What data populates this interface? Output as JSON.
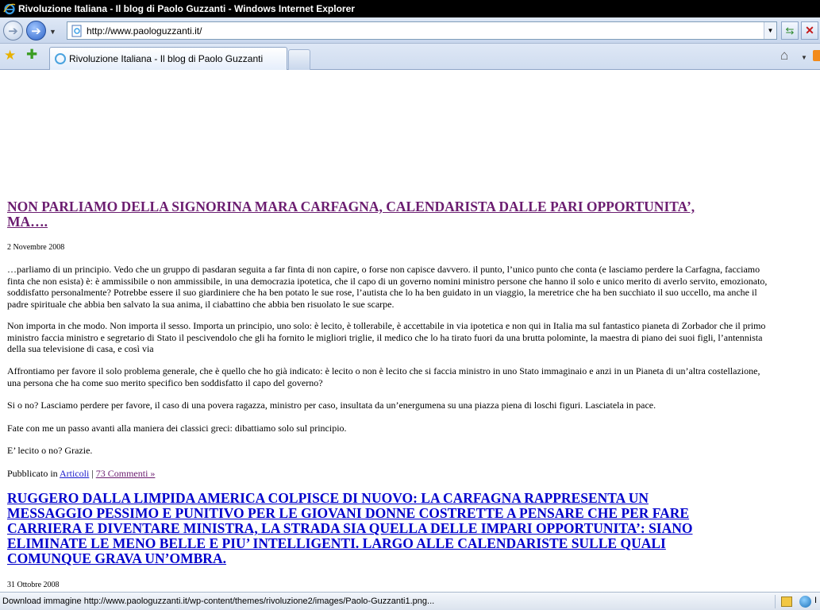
{
  "window": {
    "title": "Rivoluzione Italiana - Il blog di Paolo Guzzanti - Windows Internet Explorer",
    "url": "http://www.paologuzzanti.it/",
    "tab_label": "Rivoluzione Italiana - Il blog di Paolo Guzzanti"
  },
  "icons": {
    "back": "back-arrow-icon",
    "forward": "forward-arrow-icon",
    "refresh": "refresh-icon",
    "stop": "stop-icon",
    "favorites": "favorites-star-icon",
    "add_favorites": "add-favorites-icon",
    "home": "home-icon"
  },
  "colors": {
    "visited_link": "#6b1d70",
    "link": "#0000cc"
  },
  "posts": [
    {
      "title_line1": "NON PARLIAMO DELLA SIGNORINA MARA CARFAGNA, CALENDARISTA DALLE PARI OPPORTUNITA’,",
      "title_line2": "MA….",
      "date": "2 Novembre 2008",
      "paragraphs": [
        "…parliamo di un principio. Vedo che un gruppo di pasdaran seguita a far finta di non capire, o forse non capisce davvero. il punto, l’unico punto che conta (e lasciamo perdere la Carfagna, facciamo finta che non esista) è: è ammissibile o non ammissibile, in una democrazia ipotetica, che il capo di un governo nomini ministro persone che hanno il solo e unico merito di averlo servito, emozionato, soddisfatto personalmente? Potrebbe essere il suo giardiniere che ha ben potato le sue rose, l’autista che lo ha ben guidato in un viaggio, la meretrice che ha ben succhiato il suo uccello, ma anche il padre spirituale che abbia ben salvato la sua anima, il ciabattino che abbia ben risuolato le sue scarpe.",
        "Non importa in che modo. Non importa il sesso. Importa un principio, uno solo: è lecito, è tollerabile, è accettabile in via ipotetica e non qui in Italia ma sul fantastico pianeta di Zorbador che il primo ministro faccia ministro e segretario di Stato il pescivendolo che gli ha fornito le migliori triglie, il medico che lo ha tirato fuori da una brutta polominte, la maestra di piano dei suoi figli, l’antennista della sua televisione di casa, e così via",
        "Affrontiamo per favore il solo problema generale, che è quello che ho già indicato: è lecito o non è lecito che si faccia ministro in uno Stato immaginaio e anzi in un Pianeta di un’altra costellazione, una persona che ha come suo merito specifico ben soddisfatto il capo del governo?",
        "Si o no? Lasciamo perdere per favore, il caso di una povera ragazza, ministro per caso, insultata da un’energumena su una piazza piena di loschi figuri. Lasciatela in pace.",
        "Fate con me un passo avanti alla maniera dei classici greci: dibattiamo solo sul principio.",
        "E’ lecito o no? Grazie."
      ],
      "meta_prefix": "Pubblicato in",
      "category": "Articoli",
      "separator": "|",
      "comments": "73 Commenti »"
    },
    {
      "title_lines": [
        "RUGGERO DALLA LIMPIDA AMERICA COLPISCE DI NUOVO: LA CARFAGNA RAPPRESENTA UN",
        "MESSAGGIO PESSIMO E PUNITIVO PER LE GIOVANI DONNE COSTRETTE A PENSARE CHE PER FARE",
        "CARRIERA E DIVENTARE MINISTRA, LA STRADA SIA QUELLA DELLE IMPARI OPPORTUNITA’: SIANO",
        "ELIMINATE LE MENO BELLE  E  PIU’ INTELLIGENTI. LARGO ALLE CALENDARISTE SULLE QUALI",
        "COMUNQUE GRAVA UN’OMBRA."
      ],
      "date": "31 Ottobre 2008"
    }
  ],
  "status": {
    "text": "Download immagine http://www.paologuzzanti.it/wp-content/themes/rivoluzione2/images/Paolo-Guzzanti1.png...",
    "zone": "I"
  }
}
